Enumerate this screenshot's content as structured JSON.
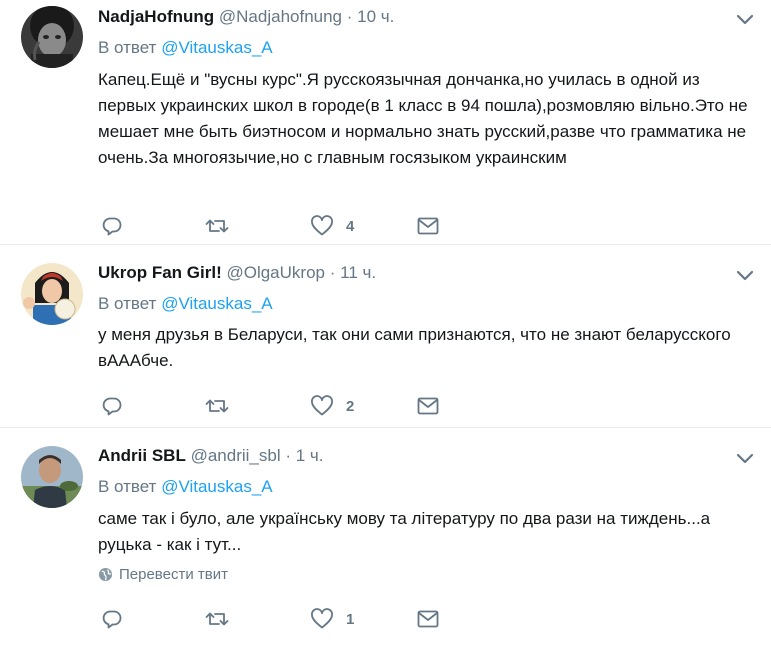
{
  "tweets": [
    {
      "fullname": "NadjaHofnung",
      "handle": "@Nadjahofnung",
      "dot": "·",
      "time": "10 ч.",
      "reply_prefix": "В ответ",
      "reply_to": "@Vitauskas_A",
      "text": "Капец.Ещё и \"вусны курс\".Я русскоязычная дончанка,но училась в одной из первых украинских школ в городе(в 1 класс в 94 пошла),розмовляю вільно.Это не мешает мне быть биэтносом и нормально знать русский,разве что грамматика не очень.За многоязычие,но с главным госязыком украинским",
      "likes": "4"
    },
    {
      "fullname": "Ukrop Fan Girl!",
      "handle": "@OlgaUkrop",
      "dot": "·",
      "time": "11 ч.",
      "reply_prefix": "В ответ",
      "reply_to": "@Vitauskas_A",
      "text": "у меня друзья в Беларуси, так они сами признаются, что не знают беларусского вАААбче.",
      "likes": "2"
    },
    {
      "fullname": "Andrii SBL",
      "handle": "@andrii_sbl",
      "dot": "·",
      "time": "1 ч.",
      "reply_prefix": "В ответ",
      "reply_to": "@Vitauskas_A",
      "text": "саме так і було, але українську мову та літературу по два рази на тиждень...а руцька - как і тут...",
      "translate": "Перевести твит",
      "likes": "1"
    }
  ],
  "icons": {
    "caret": "chevron-down-icon",
    "reply": "reply-icon",
    "retweet": "retweet-icon",
    "like": "heart-icon",
    "dm": "envelope-icon",
    "translate": "globe-icon"
  },
  "colors": {
    "link": "#1da1f2",
    "meta": "#657786",
    "text": "#14171a",
    "divider": "#e6ecf0"
  }
}
